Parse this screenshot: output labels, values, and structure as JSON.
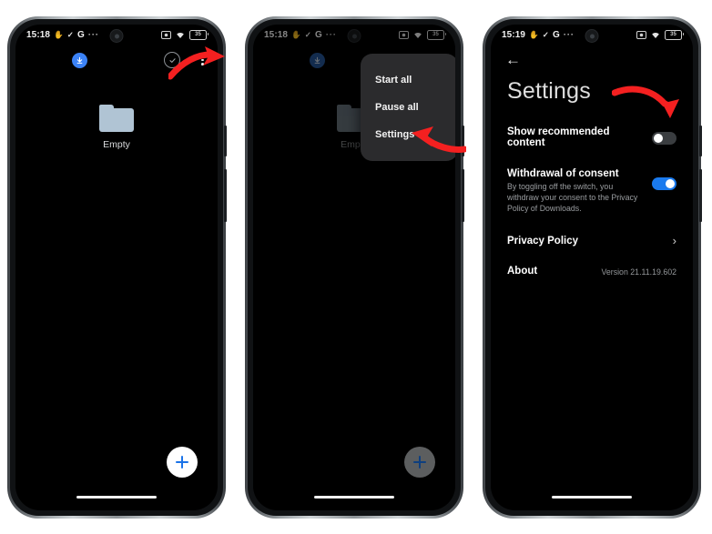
{
  "statusbar": {
    "phone1_time": "15:18",
    "phone2_time": "15:18",
    "phone3_time": "15:19",
    "icon_dnd": "✂",
    "icon_send": "✓",
    "icon_google": "G",
    "icon_overflow": "···",
    "icon_camera": "camera-icon",
    "icon_wifi": "wifi-icon",
    "battery_label": "35"
  },
  "downloads_app": {
    "toolbar": {
      "download_icon": "download-icon",
      "select_icon": "select-all-icon",
      "overflow_icon": "overflow-menu-icon"
    },
    "empty_state": {
      "icon": "folder-icon",
      "label": "Empty"
    },
    "fab_label": "+"
  },
  "popup_menu": {
    "items": [
      {
        "label": "Start all"
      },
      {
        "label": "Pause all"
      },
      {
        "label": "Settings"
      }
    ]
  },
  "settings": {
    "back_label": "←",
    "title": "Settings",
    "rows": [
      {
        "title": "Show recommended content",
        "subtitle": "",
        "control": "switch",
        "state": "off"
      },
      {
        "title": "Withdrawal of consent",
        "subtitle": "By toggling off the switch, you withdraw your consent to the Privacy Policy of Downloads.",
        "control": "switch",
        "state": "on"
      },
      {
        "title": "Privacy Policy",
        "subtitle": "",
        "control": "chevron",
        "chevron": "›"
      },
      {
        "title": "About",
        "subtitle": "",
        "control": "value",
        "value": "Version 21.11.19.602"
      }
    ]
  },
  "colors": {
    "accent_blue": "#1a7aee",
    "fab_blue": "#1a73e8",
    "annotation_red": "#f42020",
    "folder_blue": "#b0c4d4",
    "menu_bg": "#2b2b2d"
  },
  "annotations": [
    {
      "name": "arrow-to-overflow-menu"
    },
    {
      "name": "arrow-to-settings-item"
    },
    {
      "name": "arrow-to-recommended-toggle"
    }
  ]
}
